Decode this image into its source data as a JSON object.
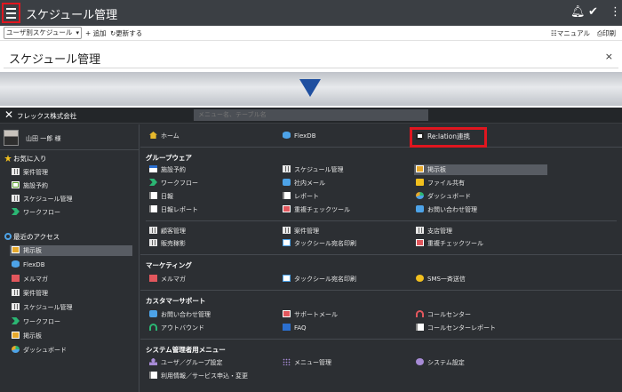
{
  "topbar": {
    "title": "スケジュール管理",
    "menu_icon": "hamburger-icon",
    "bell_icon": "bell-icon",
    "check_icon": "check-icon",
    "more_icon": "more-vertical-icon"
  },
  "toolbar": {
    "view_select": "ユーザ別スケジュール",
    "add_label": "追加",
    "refresh_label": "更新する",
    "manual_label": "マニュアル",
    "print_label": "印刷"
  },
  "page": {
    "title": "スケジュール管理",
    "close_glyph": "×"
  },
  "accent_colors": {
    "highlight_box": "#e0161f",
    "arrow": "#1f4fa0",
    "panel_bg": "#2c2f33"
  },
  "menu": {
    "company": "フレックス株式会社",
    "search_placeholder": "メニュー名、テーブル名",
    "user_name": "山田 一郎 様",
    "favorites": {
      "title": "お気に入り",
      "items": [
        "案件管理",
        "施設予約",
        "スケジュール管理",
        "ワークフロー"
      ]
    },
    "recent": {
      "title": "最近のアクセス",
      "items": [
        "掲示板",
        "FlexDB",
        "メルマガ",
        "案件管理",
        "スケジュール管理",
        "ワークフロー",
        "掲示板",
        "ダッシュボード"
      ]
    },
    "top_links": [
      "ホーム",
      "FlexDB",
      "Re:lation連携"
    ],
    "groupware": {
      "title": "グループウェア",
      "col1": [
        "施設予約",
        "ワークフロー",
        "日報",
        "日報レポート"
      ],
      "col2": [
        "スケジュール管理",
        "社内メール",
        "レポート",
        "重複チェックツール"
      ],
      "col3": [
        "掲示板",
        "ファイル共有",
        "ダッシュボード",
        "お問い合わせ管理"
      ],
      "extra1": [
        "顧客管理",
        "販売稼影"
      ],
      "extra2": [
        "案件管理",
        "タックシール宛名印刷"
      ],
      "extra3": [
        "支店管理",
        "重複チェックツール"
      ]
    },
    "marketing": {
      "title": "マーケティング",
      "items": [
        "メルマガ",
        "タックシール宛名印刷",
        "SMS一斉送信"
      ]
    },
    "customer_support": {
      "title": "カスタマーサポート",
      "col1": [
        "お問い合わせ管理",
        "アウトバウンド"
      ],
      "col2": [
        "サポートメール",
        "FAQ"
      ],
      "col3": [
        "コールセンター",
        "コールセンターレポート"
      ]
    },
    "admin": {
      "title": "システム管理者用メニュー",
      "col1": [
        "ユーザ／グループ設定",
        "利用情報／サービス申込・変更"
      ],
      "col2": [
        "メニュー管理"
      ],
      "col3": [
        "システム設定"
      ]
    }
  }
}
